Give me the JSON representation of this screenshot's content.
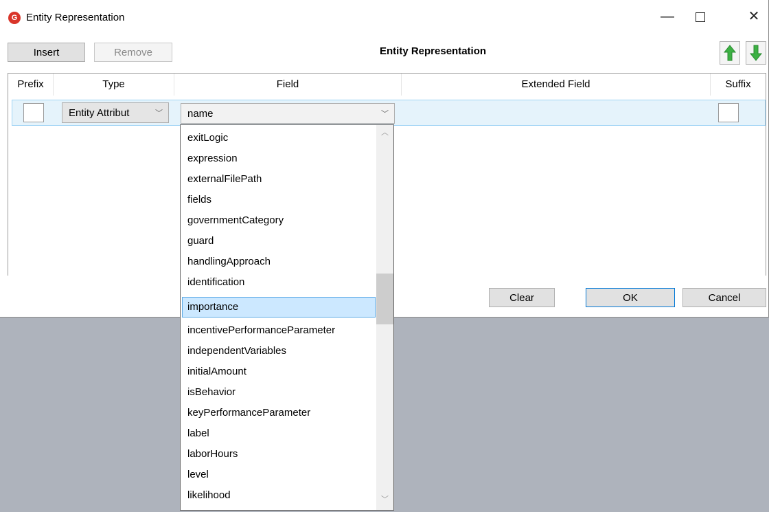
{
  "window": {
    "title": "Entity Representation",
    "app_icon_glyph": "G",
    "min_glyph": "—",
    "close_glyph": "✕"
  },
  "toolbar": {
    "insert_label": "Insert",
    "remove_label": "Remove",
    "heading": "Entity Representation",
    "move_up_icon": "green-up-arrow-icon",
    "move_down_icon": "green-down-arrow-icon"
  },
  "grid": {
    "columns": [
      "Prefix",
      "Type",
      "Field",
      "Extended Field",
      "Suffix"
    ],
    "row": {
      "type_value": "Entity Attribut",
      "field_value": "name"
    }
  },
  "footer": {
    "clear_label": "Clear",
    "ok_label": "OK",
    "cancel_label": "Cancel"
  },
  "dropdown": {
    "items": [
      "exitLogic",
      "expression",
      "externalFilePath",
      "fields",
      "governmentCategory",
      "guard",
      "handlingApproach",
      "identification",
      "importance",
      "incentivePerformanceParameter",
      "independentVariables",
      "initialAmount",
      "isBehavior",
      "keyPerformanceParameter",
      "label",
      "laborHours",
      "level",
      "likelihood"
    ],
    "selected": "importance"
  },
  "colors": {
    "selection": "#cce8ff",
    "row_highlight": "#e5f3fb",
    "arrow_green": "#3cb043",
    "desktop": "#aeb3bc"
  }
}
